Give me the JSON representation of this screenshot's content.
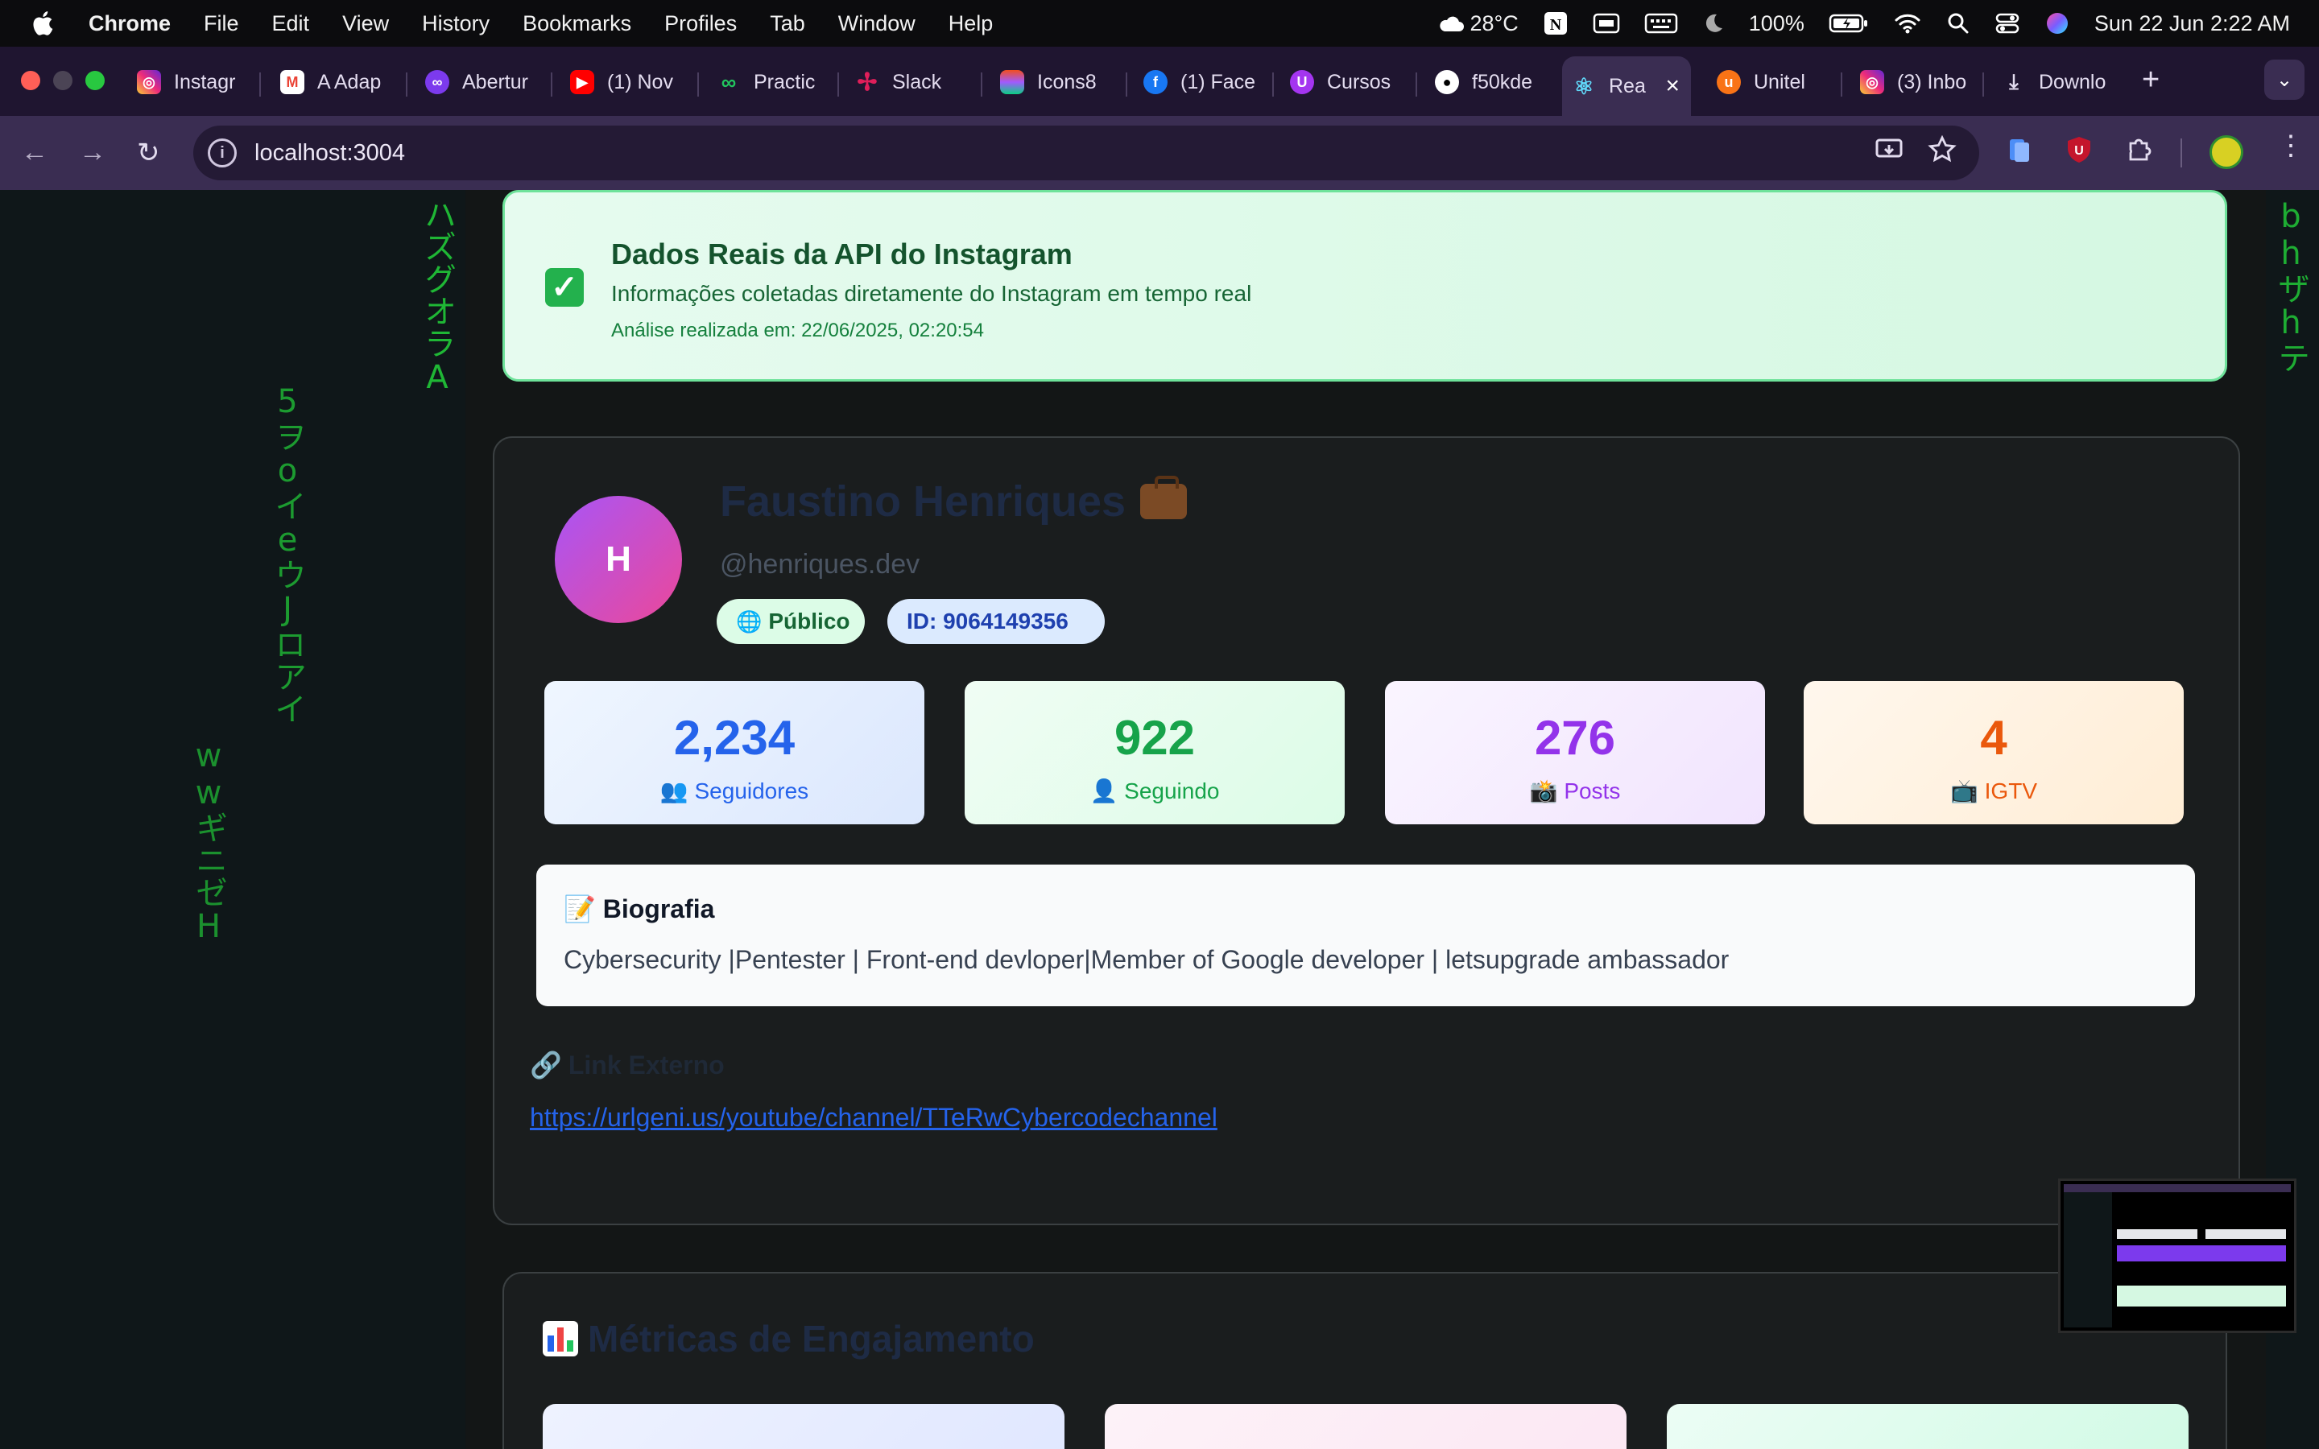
{
  "menubar": {
    "app": "Chrome",
    "items": [
      "File",
      "Edit",
      "View",
      "History",
      "Bookmarks",
      "Profiles",
      "Tab",
      "Window",
      "Help"
    ],
    "weather": "28°C",
    "battery": "100%",
    "datetime": "Sun 22 Jun  2:22 AM"
  },
  "tabs": [
    {
      "label": "Instagr",
      "icon": "instagram-icon",
      "color": "#e1306c"
    },
    {
      "label": "A Adap",
      "icon": "gmail-icon",
      "color": "#ea4335"
    },
    {
      "label": "Abertur",
      "icon": "app-icon",
      "color": "#7c3aed"
    },
    {
      "label": "(1) Nov",
      "icon": "youtube-icon",
      "color": "#ff0000"
    },
    {
      "label": "Practic",
      "icon": "practice-icon",
      "color": "#22c55e"
    },
    {
      "label": "Slack",
      "icon": "slack-icon",
      "color": "#e01e5a"
    },
    {
      "label": "Icons8",
      "icon": "figma-icon",
      "color": "#f24e1e"
    },
    {
      "label": "(1) Face",
      "icon": "facebook-icon",
      "color": "#1877f2"
    },
    {
      "label": "Cursos",
      "icon": "udemy-icon",
      "color": "#a435f0"
    },
    {
      "label": "f50kde",
      "icon": "github-icon",
      "color": "#ffffff"
    },
    {
      "label": "Rea",
      "icon": "react-icon",
      "color": "#61dafb",
      "active": true
    },
    {
      "label": "Unitel",
      "icon": "unitel-icon",
      "color": "#f97316"
    },
    {
      "label": "(3) Inbo",
      "icon": "instagram-icon",
      "color": "#e1306c"
    },
    {
      "label": "Downlo",
      "icon": "download-icon",
      "color": "#e3dcef"
    }
  ],
  "address": {
    "url": "localhost:3004"
  },
  "banner": {
    "title": "Dados Reais da API do Instagram",
    "subtitle": "Informações coletadas diretamente do Instagram em tempo real",
    "timestamp": "Análise realizada em: 22/06/2025, 02:20:54"
  },
  "profile": {
    "avatar_letter": "H",
    "name": "Faustino Henriques",
    "username": "@henriques.dev",
    "visibility": "Público",
    "id_label": "ID: 9064149356"
  },
  "stats": [
    {
      "value": "2,234",
      "label": "Seguidores",
      "emoji": "👥"
    },
    {
      "value": "922",
      "label": "Seguindo",
      "emoji": "👤"
    },
    {
      "value": "276",
      "label": "Posts",
      "emoji": "📸"
    },
    {
      "value": "4",
      "label": "IGTV",
      "emoji": "📺"
    }
  ],
  "bio": {
    "heading": "Biografia",
    "text": "Cybersecurity |Pentester | Front-end devloper|Member of Google developer | letsupgrade ambassador"
  },
  "external_link": {
    "heading": "Link Externo",
    "url": "https://urlgeni.us/youtube/channel/TTeRwCybercodechannel"
  },
  "engagement": {
    "heading": "Métricas de Engajamento"
  },
  "matrix_columns": [
    {
      "chars": "ハズグオラA"
    },
    {
      "chars": "5ヲoイeウJロアイ"
    },
    {
      "chars": "wwギニゼH"
    },
    {
      "chars": "bhザhテ"
    }
  ]
}
